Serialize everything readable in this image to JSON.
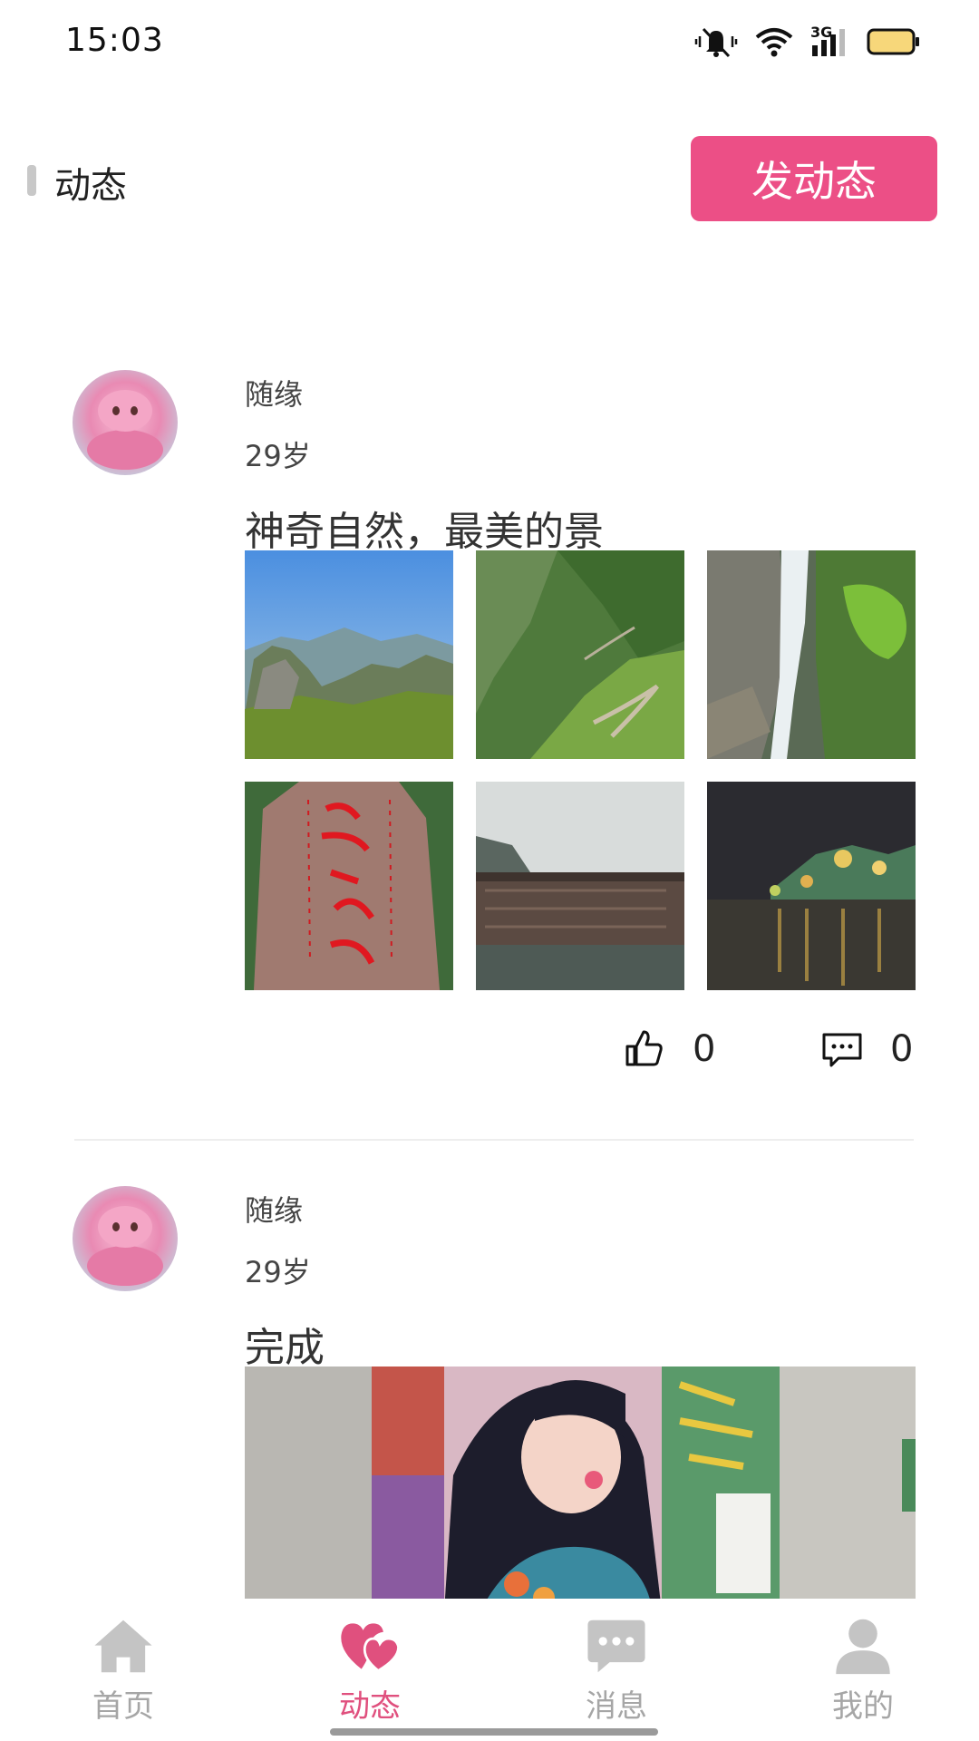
{
  "status_bar": {
    "time": "15:03",
    "icons": [
      "mute-icon",
      "wifi-icon",
      "signal-3g-icon",
      "battery-icon"
    ],
    "network_label": "3G"
  },
  "header": {
    "title": "动态",
    "post_button_label": "发动态"
  },
  "colors": {
    "accent": "#ec4f86",
    "tab_active": "#e0507e",
    "tab_inactive": "#a6a6a6"
  },
  "posts": [
    {
      "user_name": "随缘",
      "user_age": "29岁",
      "text": "神奇自然，最美的景",
      "images": [
        "mountain-peaks-photo",
        "green-valley-photo",
        "waterfall-photo",
        "red-calligraphy-rock-photo",
        "riverside-stilt-houses-photo",
        "night-river-town-photo"
      ],
      "likes": "0",
      "comments": "0"
    },
    {
      "user_name": "随缘",
      "user_age": "29岁",
      "text": "完成",
      "images": [
        "diamond-painting-girl-photo"
      ]
    }
  ],
  "tabs": [
    {
      "label": "首页",
      "icon": "home-icon",
      "active": false
    },
    {
      "label": "动态",
      "icon": "hearts-icon",
      "active": true
    },
    {
      "label": "消息",
      "icon": "chat-bubble-icon",
      "active": false
    },
    {
      "label": "我的",
      "icon": "person-icon",
      "active": false
    }
  ]
}
